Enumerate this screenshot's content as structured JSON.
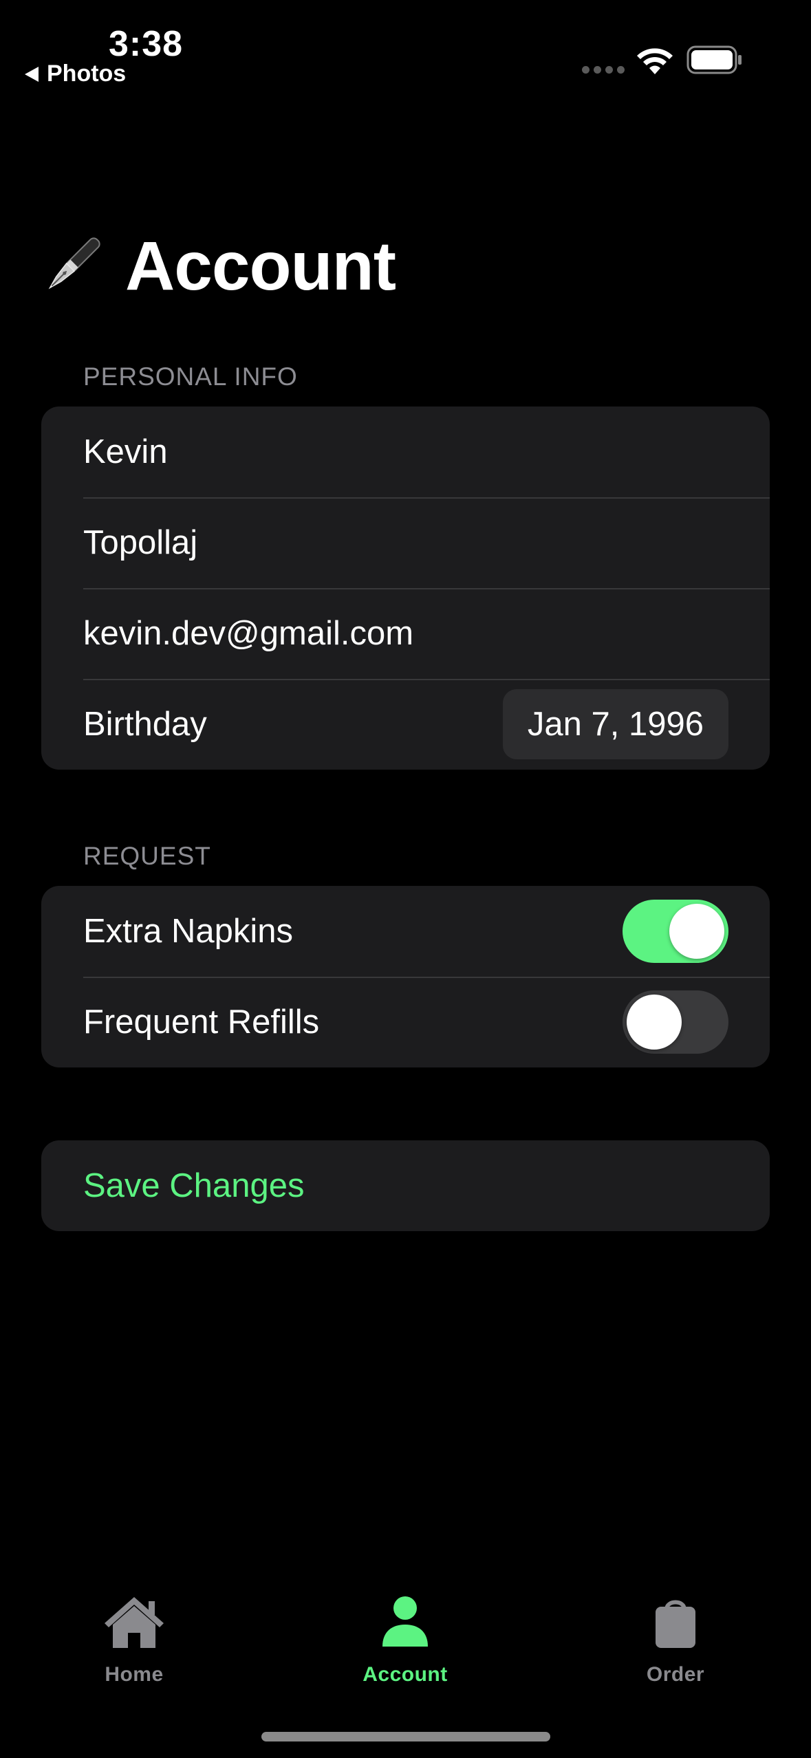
{
  "status_bar": {
    "time": "3:38",
    "back_label": "Photos"
  },
  "header": {
    "title": "Account",
    "icon": "fountain-pen-icon"
  },
  "personal_info": {
    "section_title": "PERSONAL INFO",
    "first_name": "Kevin",
    "last_name": "Topollaj",
    "email": "kevin.dev@gmail.com",
    "birthday_label": "Birthday",
    "birthday_value": "Jan 7, 1996"
  },
  "request": {
    "section_title": "REQUEST",
    "items": [
      {
        "label": "Extra Napkins",
        "enabled": true
      },
      {
        "label": "Frequent Refills",
        "enabled": false
      }
    ]
  },
  "actions": {
    "save_label": "Save Changes"
  },
  "tab_bar": {
    "tabs": [
      {
        "label": "Home",
        "icon": "house-icon",
        "active": false
      },
      {
        "label": "Account",
        "icon": "person-icon",
        "active": true
      },
      {
        "label": "Order",
        "icon": "bag-icon",
        "active": false
      }
    ]
  },
  "colors": {
    "accent": "#5cf382",
    "background": "#000000",
    "group_background": "#1c1c1e",
    "secondary_text": "#8d8d93",
    "inactive_tab": "#8a8a8e"
  }
}
